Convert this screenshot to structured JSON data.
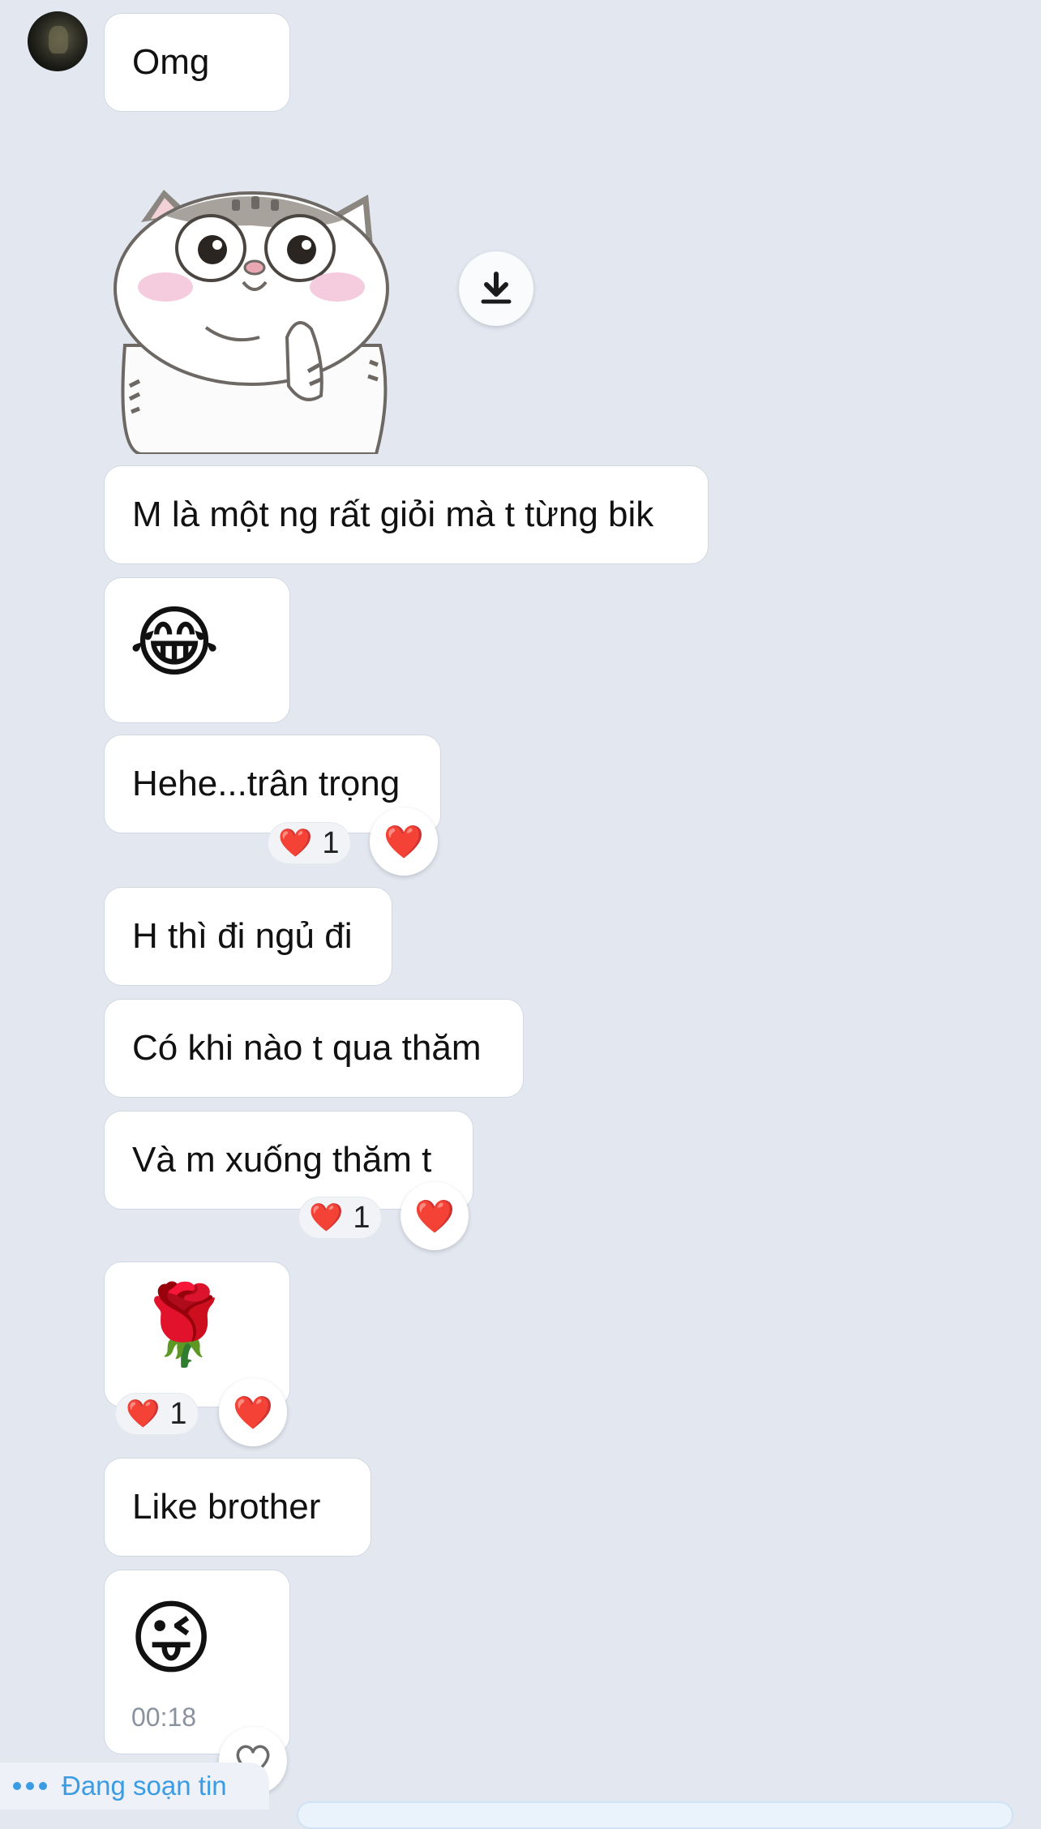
{
  "messages": [
    {
      "id": "m1",
      "text": "Omg"
    },
    {
      "id": "m2",
      "text": "M là một ng rất giỏi mà t từng bik"
    },
    {
      "id": "m3",
      "text": "😂"
    },
    {
      "id": "m4",
      "text": "Hehe...trân trọng",
      "reaction": {
        "emoji": "❤️",
        "count": "1"
      }
    },
    {
      "id": "m5",
      "text": "H thì đi ngủ đi"
    },
    {
      "id": "m6",
      "text": "Có khi nào t qua thăm"
    },
    {
      "id": "m7",
      "text": "Và m xuống thăm t",
      "reaction": {
        "emoji": "❤️",
        "count": "1"
      }
    },
    {
      "id": "m8",
      "text": "🌹",
      "reaction": {
        "emoji": "❤️",
        "count": "1"
      }
    },
    {
      "id": "m9",
      "text": "Like brother"
    },
    {
      "id": "m10",
      "text": "😜",
      "time": "00:18"
    }
  ],
  "react_button_emoji": "❤️",
  "typing": {
    "text": "Đang soạn tin"
  },
  "icons": {
    "avatar": "contact-avatar",
    "download": "download-icon",
    "react": "heart-icon",
    "like": "heart-outline-icon"
  },
  "colors": {
    "background": "#e2e7f0",
    "bubble": "#ffffff",
    "accent": "#3b9be3",
    "heart": "#e0202a"
  }
}
